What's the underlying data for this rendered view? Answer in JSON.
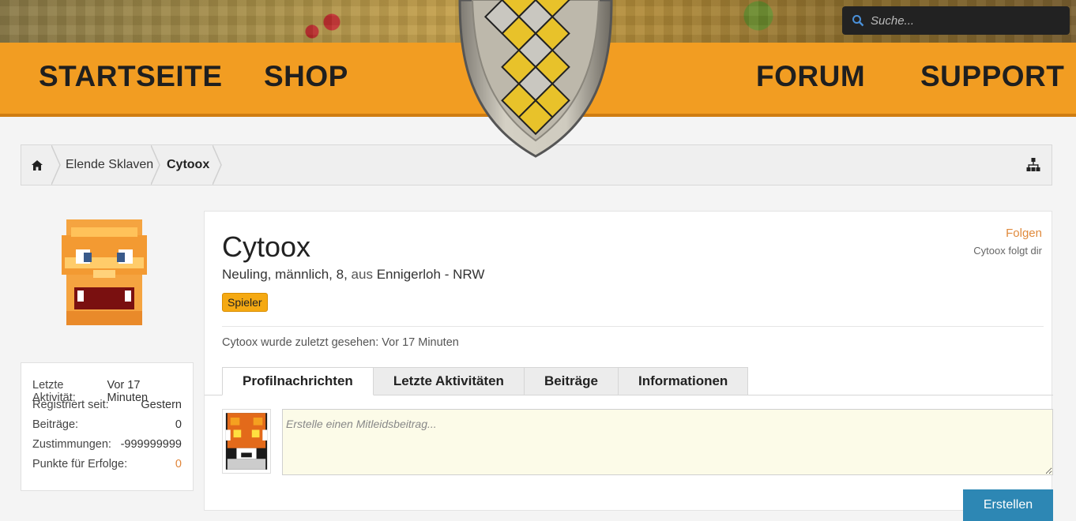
{
  "search": {
    "placeholder": "Suche..."
  },
  "nav": {
    "items": [
      "STARTSEITE",
      "SHOP",
      "FORUM",
      "SUPPORT"
    ]
  },
  "breadcrumb": {
    "items": [
      "Elende Sklaven",
      "Cytoox"
    ]
  },
  "sidebar": {
    "stats": [
      {
        "label": "Letzte Aktivität:",
        "value": "Vor 17 Minuten"
      },
      {
        "label": "Registriert seit:",
        "value": "Gestern"
      },
      {
        "label": "Beiträge:",
        "value": "0"
      },
      {
        "label": "Zustimmungen:",
        "value": "-999999999"
      },
      {
        "label": "Punkte für Erfolge:",
        "value": "0"
      }
    ]
  },
  "profile": {
    "username": "Cytoox",
    "title": "Neuling",
    "gender": "männlich",
    "age": "8",
    "from_label": "aus",
    "location": "Ennigerloh - NRW",
    "rank": "Spieler",
    "follow_label": "Folgen",
    "follows_you": "Cytoox folgt dir",
    "last_seen": "Cytoox wurde zuletzt gesehen: Vor 17 Minuten"
  },
  "tabs": [
    "Profilnachrichten",
    "Letzte Aktivitäten",
    "Beiträge",
    "Informationen"
  ],
  "message": {
    "placeholder": "Erstelle einen Mitleidsbeitrag...",
    "submit_label": "Erstellen"
  },
  "colors": {
    "nav_orange": "#f29d22",
    "accent": "#e0853a",
    "badge": "#f5a912",
    "button": "#2d87b4"
  }
}
